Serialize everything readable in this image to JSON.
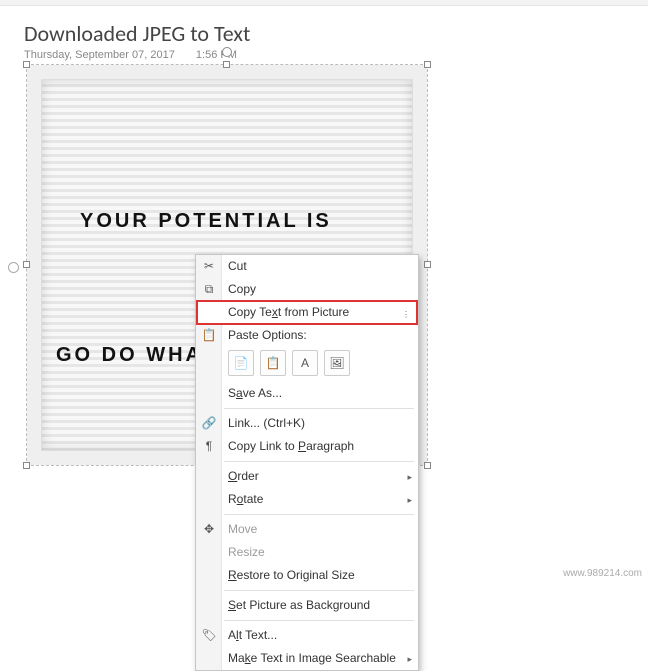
{
  "page": {
    "title": "Downloaded JPEG to Text",
    "date": "Thursday, September 07, 2017",
    "time": "1:56 PM"
  },
  "image": {
    "line1": "YOUR POTENTIAL IS",
    "line2": "GO DO WHAT Y"
  },
  "ctx": {
    "cut": "Cut",
    "copy": "Copy",
    "copyTextFromPicture": "Copy Text from Picture",
    "pasteOptionsLabel": "Paste Options:",
    "saveAs": "Save As...",
    "link": "Link...  (Ctrl+K)",
    "copyLinkParagraph": "Copy Link to Paragraph",
    "order": "Order",
    "rotate": "Rotate",
    "move": "Move",
    "resize": "Resize",
    "restore": "Restore to Original Size",
    "setBackground": "Set Picture as Background",
    "altText": "Alt Text...",
    "makeSearchable": "Make Text in Image Searchable"
  },
  "watermark": "www.989214.com"
}
